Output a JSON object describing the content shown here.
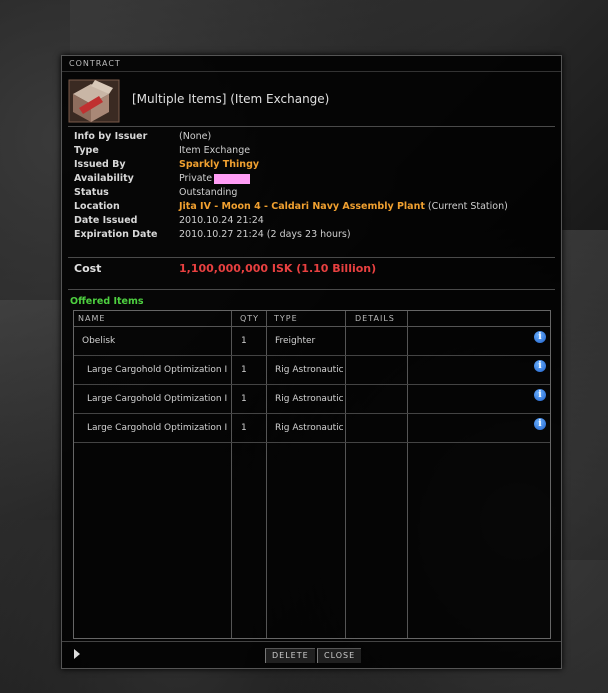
{
  "window": {
    "title": "CONTRACT",
    "contract_title": "[Multiple Items] (Item Exchange)"
  },
  "info": {
    "rows": [
      {
        "label": "Info by Issuer",
        "value": "(None)"
      },
      {
        "label": "Type",
        "value": "Item Exchange"
      },
      {
        "label": "Issued By",
        "value": "Sparkly Thingy"
      },
      {
        "label": "Availability",
        "value": "Private"
      },
      {
        "label": "Status",
        "value": "Outstanding"
      },
      {
        "label": "Location",
        "value": "Jita IV - Moon 4 - Caldari Navy Assembly Plant",
        "suffix": "(Current Station)"
      },
      {
        "label": "Date Issued",
        "value": "2010.10.24 21:24"
      },
      {
        "label": "Expiration Date",
        "value": "2010.10.27 21:24 (2 days 23 hours)"
      }
    ]
  },
  "cost": {
    "label": "Cost",
    "value": "1,100,000,000 ISK (1.10 Billion)"
  },
  "offered": {
    "label": "Offered Items",
    "columns": [
      "NAME",
      "QTY",
      "TYPE",
      "DETAILS"
    ],
    "rows": [
      {
        "name": "Obelisk",
        "qty": "1",
        "type": "Freighter",
        "details": "",
        "info": "i"
      },
      {
        "name": "Large Cargohold Optimization I",
        "qty": "1",
        "type": "Rig Astronautic",
        "details": "",
        "info": "i"
      },
      {
        "name": "Large Cargohold Optimization I",
        "qty": "1",
        "type": "Rig Astronautic",
        "details": "",
        "info": "i"
      },
      {
        "name": "Large Cargohold Optimization I",
        "qty": "1",
        "type": "Rig Astronautic",
        "details": "",
        "info": "i"
      }
    ]
  },
  "footer": {
    "delete_label": "DELETE",
    "close_label": "CLOSE"
  },
  "colors": {
    "accent_orange": "#f0a030",
    "cost_red": "#e84040",
    "offered_green": "#4ed040",
    "availability_redacted": "#ff9df5"
  },
  "icons": {
    "contract": "contract-item-exchange-icon",
    "info": "info-icon",
    "expand": "expand-arrow-icon"
  }
}
